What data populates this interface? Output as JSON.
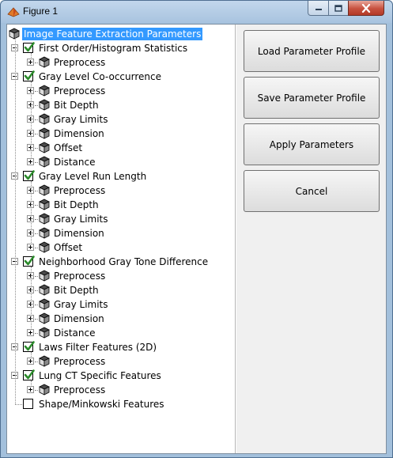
{
  "window": {
    "title": "Figure 1"
  },
  "colors": {
    "selection": "#3399ff",
    "checkmark": "#2a8a2a",
    "titlebar": "#b8d0e8"
  },
  "tree": {
    "root": {
      "label": "Image Feature Extraction Parameters",
      "icon": "cube-icon"
    },
    "groups": [
      {
        "label": "First Order/Histogram Statistics",
        "checked": true,
        "children": [
          "Preprocess"
        ]
      },
      {
        "label": "Gray Level Co-occurrence",
        "checked": true,
        "children": [
          "Preprocess",
          "Bit Depth",
          "Gray Limits",
          "Dimension",
          "Offset",
          "Distance"
        ]
      },
      {
        "label": "Gray Level Run Length",
        "checked": true,
        "children": [
          "Preprocess",
          "Bit Depth",
          "Gray Limits",
          "Dimension",
          "Offset"
        ]
      },
      {
        "label": "Neighborhood Gray Tone Difference",
        "checked": true,
        "children": [
          "Preprocess",
          "Bit Depth",
          "Gray Limits",
          "Dimension",
          "Distance"
        ]
      },
      {
        "label": "Laws Filter Features (2D)",
        "checked": true,
        "children": [
          "Preprocess"
        ]
      },
      {
        "label": "Lung CT Specific Features",
        "checked": true,
        "children": [
          "Preprocess"
        ]
      },
      {
        "label": "Shape/Minkowski Features",
        "checked": false,
        "children": []
      }
    ]
  },
  "buttons": {
    "load": "Load Parameter Profile",
    "save": "Save Parameter Profile",
    "apply": "Apply Parameters",
    "cancel": "Cancel"
  }
}
